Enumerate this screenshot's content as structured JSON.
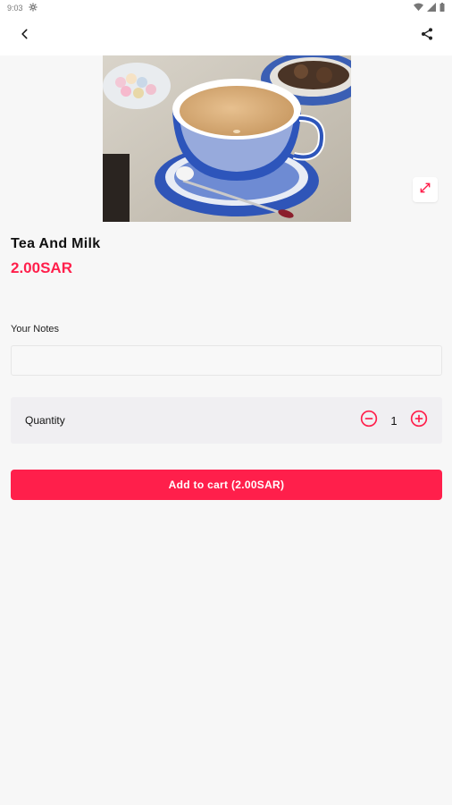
{
  "status_bar": {
    "time": "9:03",
    "icons": [
      "settings-gear-icon",
      "wifi-icon",
      "signal-icon",
      "battery-icon"
    ]
  },
  "app_bar": {
    "back_icon": "chevron-left-icon",
    "share_icon": "share-icon"
  },
  "product": {
    "image_alt": "Tea And Milk",
    "expand_icon": "expand-icon",
    "name": "Tea And Milk",
    "price": "2.00SAR"
  },
  "notes": {
    "label": "Your Notes",
    "value": "",
    "placeholder": ""
  },
  "quantity": {
    "label": "Quantity",
    "value": "1",
    "decrement_icon": "minus-circle-icon",
    "increment_icon": "plus-circle-icon"
  },
  "cart": {
    "button_label": "Add to cart (2.00SAR)"
  },
  "colors": {
    "accent": "#ff1f4b",
    "background": "#f7f7f7",
    "quantity_box": "#f0eff2"
  }
}
